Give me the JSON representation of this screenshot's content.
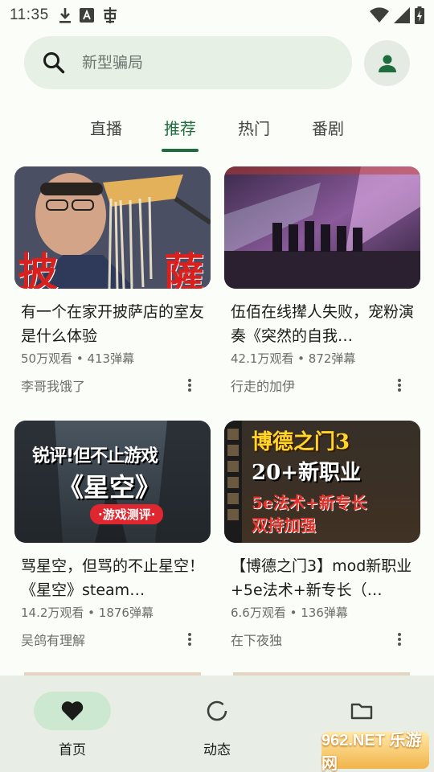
{
  "status_bar": {
    "time": "11:35"
  },
  "search": {
    "placeholder": "新型骗局"
  },
  "tabs": [
    {
      "label": "直播",
      "active": false
    },
    {
      "label": "推荐",
      "active": true
    },
    {
      "label": "热门",
      "active": false
    },
    {
      "label": "番剧",
      "active": false
    }
  ],
  "videos": [
    {
      "title": "有一个在家开披萨店的室友是什么体验",
      "stats": "50万观看 • 413弹幕",
      "author": "李哥我饿了",
      "thumb_text": [
        "披",
        "薩"
      ]
    },
    {
      "title": "伍佰在线撵人失败，宠粉演奏《突然的自我…",
      "stats": "42.1万观看 • 872弹幕",
      "author": "行走的加伊"
    },
    {
      "title": "骂星空，但骂的不止星空！《星空》steam…",
      "stats": "14.2万观看 • 1876弹幕",
      "author": "吴鸽有理解",
      "thumb_text": [
        "锐评!但不止游戏",
        "《星空》",
        "·游戏测评·"
      ]
    },
    {
      "title": "【博德之门3】mod新职业+5e法术+新专长（…",
      "stats": "6.6万观看 • 136弹幕",
      "author": "在下夜独",
      "thumb_text": [
        "博德之门3",
        "20+新职业",
        "5e法术+新专长",
        "双持加强"
      ]
    }
  ],
  "bottom_nav": [
    {
      "label": "首页",
      "icon": "heart-icon",
      "active": true
    },
    {
      "label": "动态",
      "icon": "loading-circle-icon",
      "active": false
    },
    {
      "label": "",
      "icon": "folder-icon",
      "active": false
    }
  ],
  "watermark": "962.NET 乐游网",
  "colors": {
    "accent": "#1f6d3e",
    "search_bg": "#e6f0e4",
    "nav_bg": "#e8eee5",
    "nav_active": "#cde8d0"
  }
}
